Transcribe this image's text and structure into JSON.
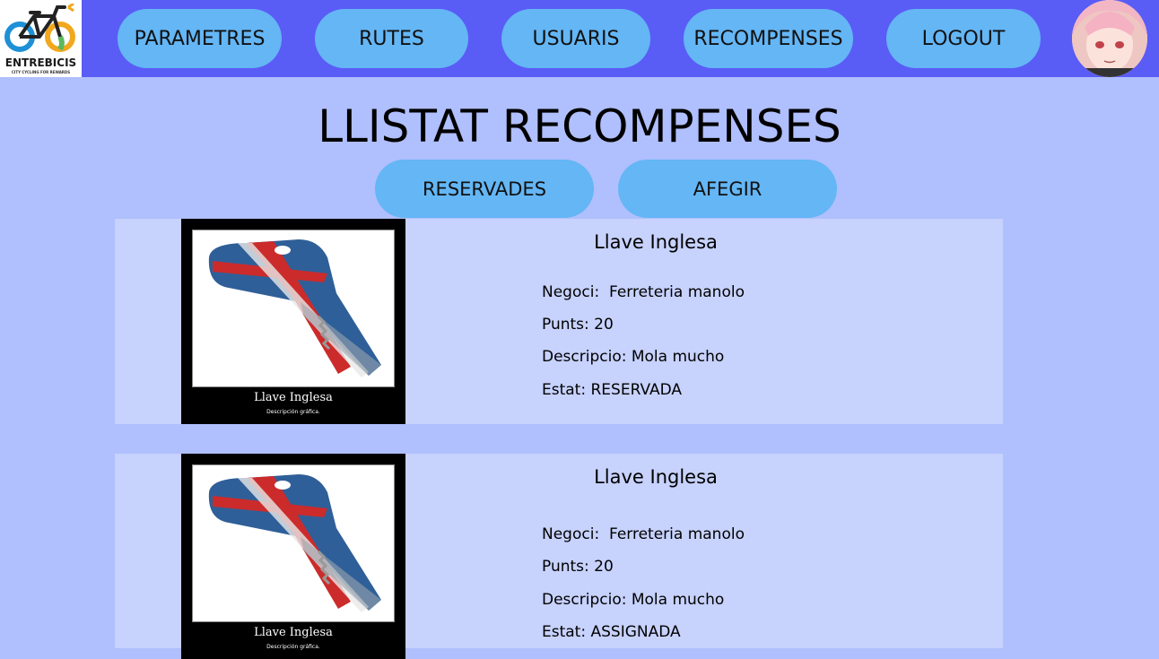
{
  "logo": {
    "name": "ENTREBICIS",
    "tagline": "CITY CYCLING FOR REWARDS"
  },
  "nav": {
    "items": [
      {
        "label": "PARAMETRES"
      },
      {
        "label": "RUTES"
      },
      {
        "label": "USUARIS"
      },
      {
        "label": "RECOMPENSES"
      },
      {
        "label": "LOGOUT"
      }
    ]
  },
  "page": {
    "title": "LLISTAT RECOMPENSES"
  },
  "actions": {
    "reserved_label": "RESERVADES",
    "add_label": "AFEGIR"
  },
  "rewards": [
    {
      "name": "Llave Inglesa",
      "business": "Negoci:  Ferreteria manolo",
      "points": "Punts: 20",
      "description": "Descripcio: Mola mucho",
      "status": "Estat: RESERVADA",
      "image_caption": "Llave Inglesa",
      "image_subcaption": "Descripción gráfica."
    },
    {
      "name": "Llave Inglesa",
      "business": "Negoci:  Ferreteria manolo",
      "points": "Punts: 20",
      "description": "Descripcio: Mola mucho",
      "status": "Estat: ASSIGNADA",
      "image_caption": "Llave Inglesa",
      "image_subcaption": "Descripción gráfica."
    }
  ],
  "colors": {
    "topbar": "#5a5cf6",
    "background": "#b0bffd",
    "button": "#64b6f5",
    "card": "#c7d2fd"
  }
}
